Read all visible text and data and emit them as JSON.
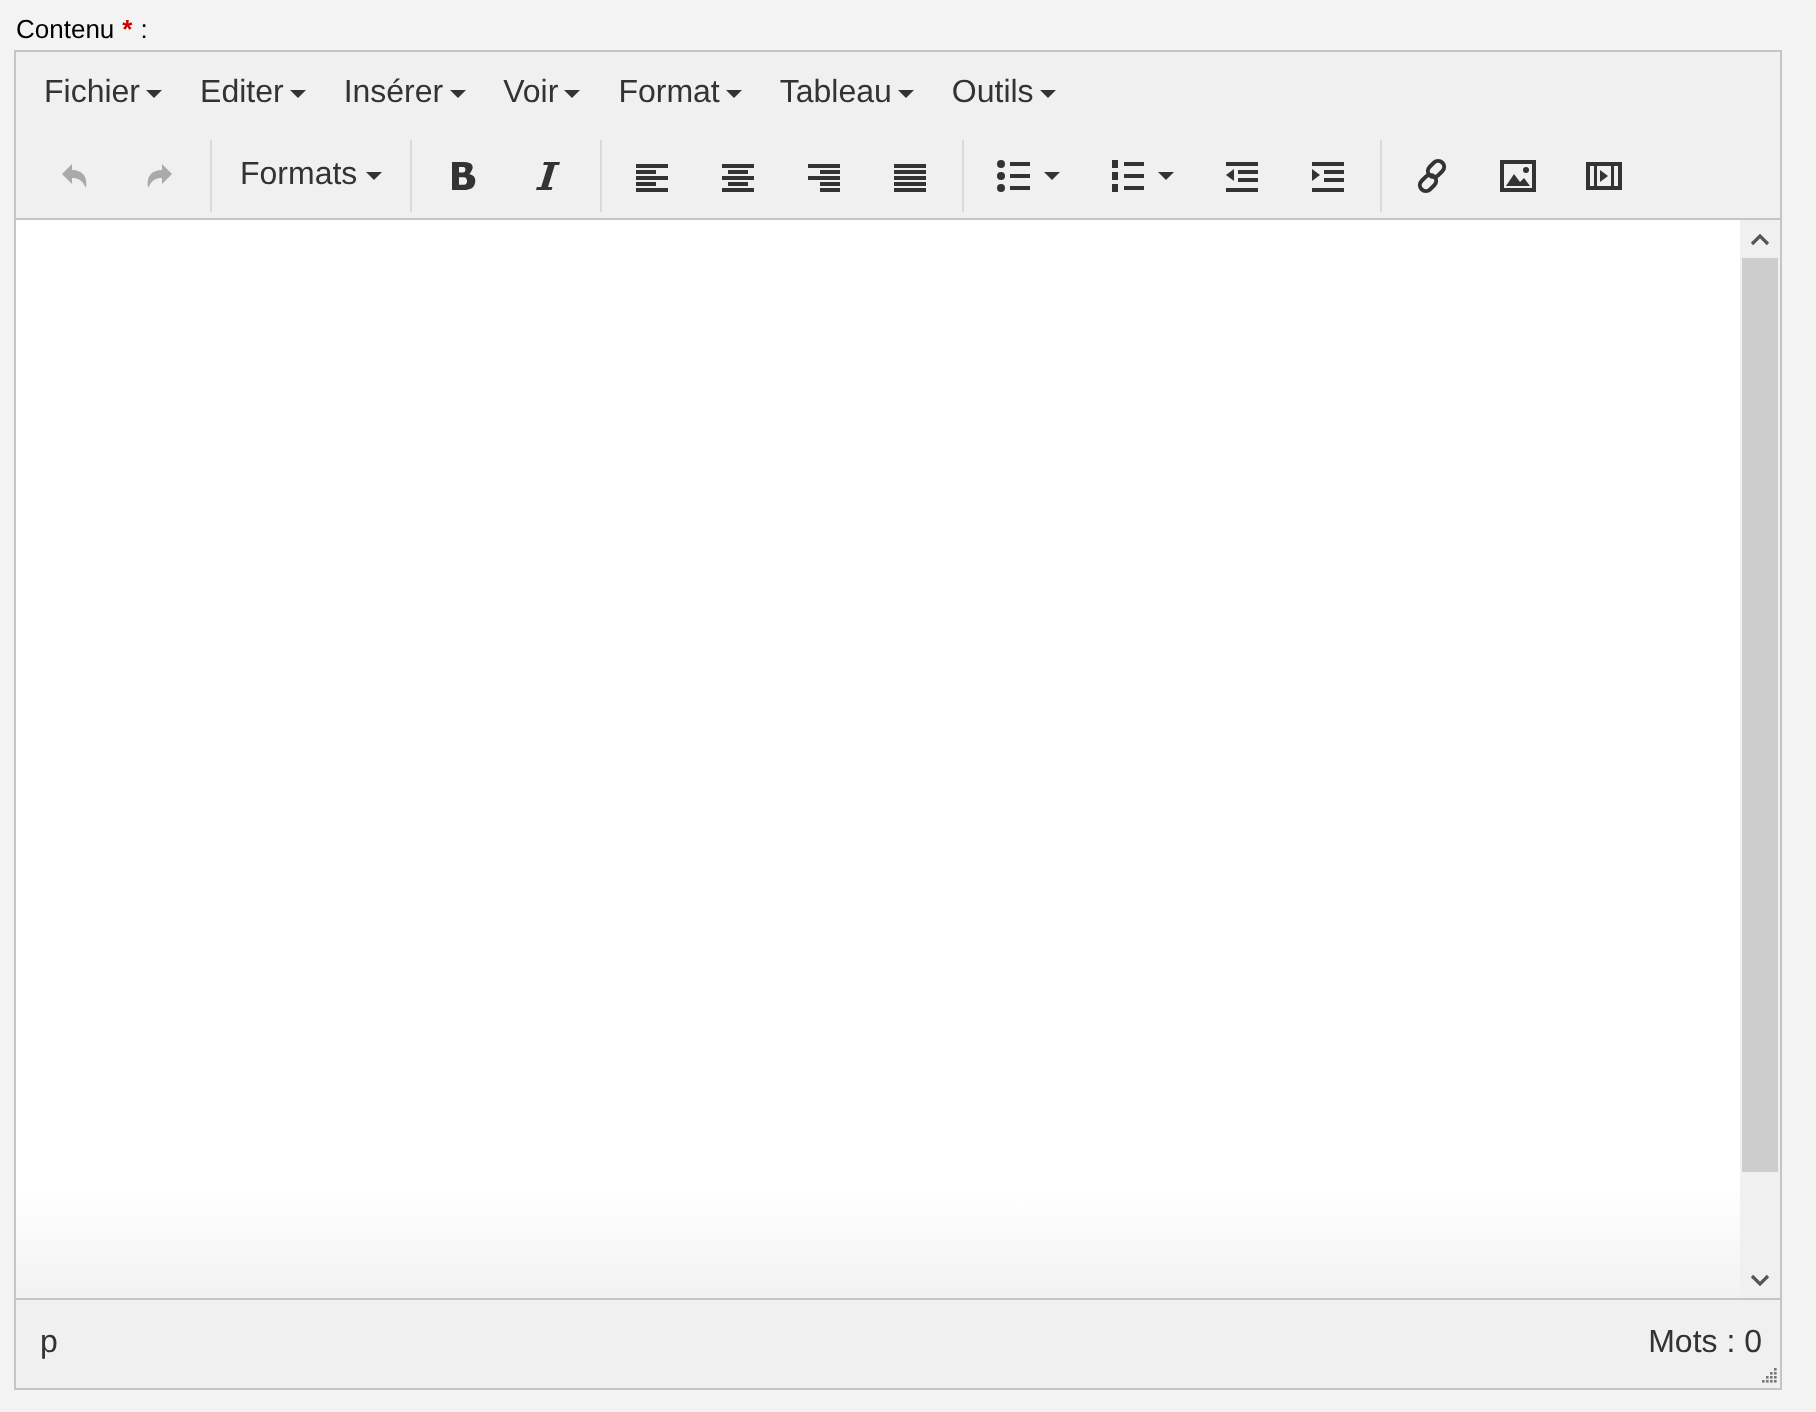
{
  "field_label": {
    "text": "Contenu",
    "required_mark": "*",
    "suffix": ":"
  },
  "menubar": [
    {
      "label": "Fichier"
    },
    {
      "label": "Editer"
    },
    {
      "label": "Insérer"
    },
    {
      "label": "Voir"
    },
    {
      "label": "Format"
    },
    {
      "label": "Tableau"
    },
    {
      "label": "Outils"
    }
  ],
  "toolbar": [
    [
      {
        "kind": "undo",
        "disabled": true
      },
      {
        "kind": "redo",
        "disabled": true
      }
    ],
    [
      {
        "kind": "formats",
        "label": "Formats",
        "disabled": false
      }
    ],
    [
      {
        "kind": "bold",
        "disabled": false
      },
      {
        "kind": "italic",
        "disabled": false
      }
    ],
    [
      {
        "kind": "alignleft",
        "disabled": false
      },
      {
        "kind": "aligncenter",
        "disabled": false
      },
      {
        "kind": "alignright",
        "disabled": false
      },
      {
        "kind": "justify",
        "disabled": false
      }
    ],
    [
      {
        "kind": "bullist",
        "disabled": false
      },
      {
        "kind": "numlist",
        "disabled": false
      },
      {
        "kind": "outdent",
        "disabled": false
      },
      {
        "kind": "indent",
        "disabled": false
      }
    ],
    [
      {
        "kind": "link",
        "disabled": false
      },
      {
        "kind": "image",
        "disabled": false
      },
      {
        "kind": "media",
        "disabled": false
      }
    ]
  ],
  "status_bar": {
    "path": "p",
    "word_count": "Mots : 0"
  }
}
